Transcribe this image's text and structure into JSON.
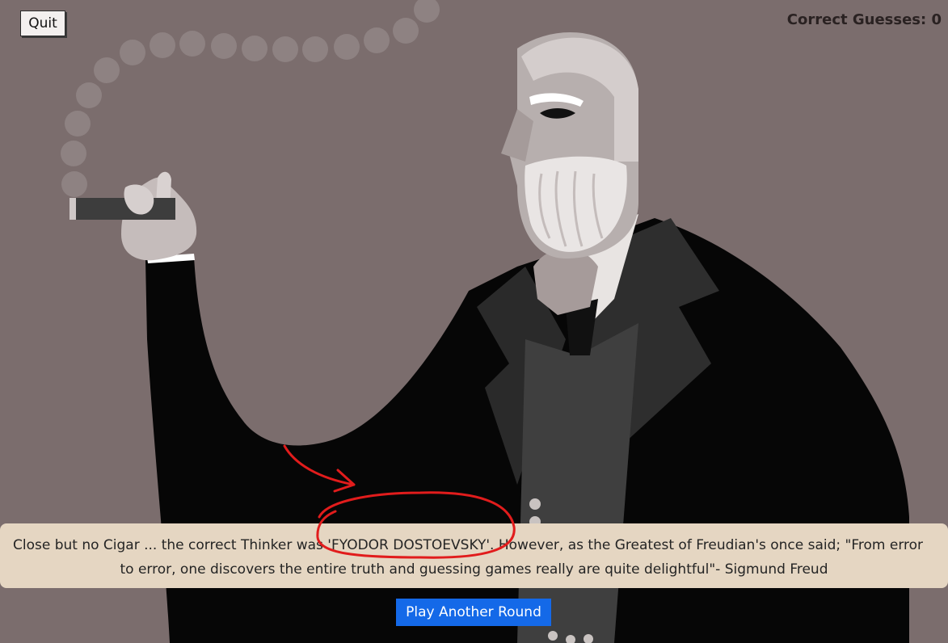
{
  "game": {
    "quit_label": "Quit",
    "score_text": "Correct Guesses: 0",
    "result_line1": "Close but no Cigar ... the correct Thinker was 'FYODOR DOSTOEVSKY'. However, as the Greatest of Freudian's once said; \"From error",
    "result_line2": "to error, one discovers the entire truth and guessing games really are quite delightful\"- Sigmund Freud",
    "play_again_label": "Play Another Round"
  },
  "illustration": {
    "subject": "freud-figure",
    "icon": "cigar-icon"
  },
  "colors": {
    "background": "#7b6d6d",
    "message_panel": "#e5d6c2",
    "play_button": "#1469e8",
    "annotation": "#e11c1c"
  }
}
